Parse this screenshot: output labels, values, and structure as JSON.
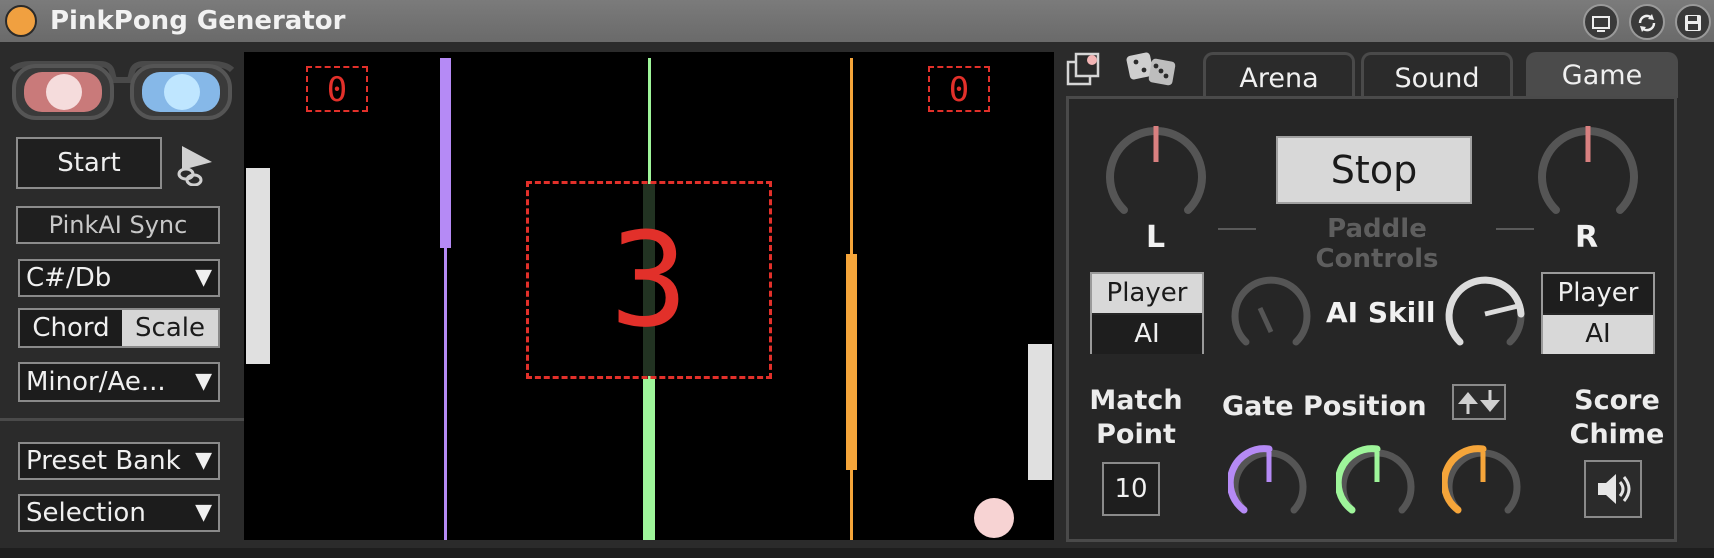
{
  "window": {
    "title": "PinkPong Generator",
    "controls": [
      "screen-icon",
      "sync-icon",
      "save-icon"
    ]
  },
  "left_panel": {
    "start_label": "Start",
    "sync_label": "PinkAI Sync",
    "key_value": "C#/Db",
    "chord_label": "Chord",
    "scale_label": "Scale",
    "mode_value": "Minor/Ae...",
    "preset_bank_value": "Preset Bank",
    "selection_value": "Selection"
  },
  "arena": {
    "score_left": "0",
    "score_right": "0",
    "countdown": "3"
  },
  "tabs": [
    {
      "label": "Arena"
    },
    {
      "label": "Sound"
    },
    {
      "label": "Game"
    }
  ],
  "game": {
    "stop_label": "Stop",
    "paddle_controls_label": "Paddle Controls",
    "left_knob_label": "L",
    "right_knob_label": "R",
    "left_mode": {
      "player": "Player",
      "ai": "AI",
      "selected": "Player"
    },
    "right_mode": {
      "player": "Player",
      "ai": "AI",
      "selected": "AI"
    },
    "ai_skill_label": "AI Skill",
    "match_point_label_1": "Match",
    "match_point_label_2": "Point",
    "match_point_value": "10",
    "gate_position_label": "Gate Position",
    "score_chime_label_1": "Score",
    "score_chime_label_2": "Chime"
  },
  "colors": {
    "accent_red": "#e2302a",
    "gate_purple": "#b58af5",
    "gate_green": "#9ef59a",
    "gate_orange": "#f5a53a",
    "ball_pink": "#f7d3d3"
  }
}
